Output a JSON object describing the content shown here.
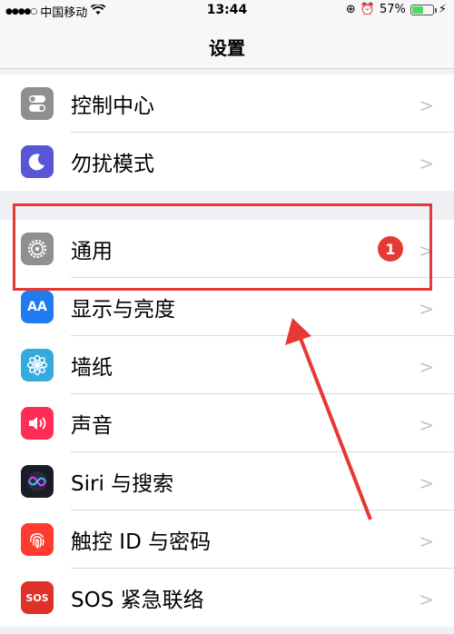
{
  "status_bar": {
    "carrier": "中国移动",
    "time": "13:44",
    "battery": "57%",
    "battery_level": 0.57
  },
  "nav": {
    "title": "设置"
  },
  "groups": [
    {
      "items": [
        {
          "label": "控制中心",
          "icon": "control-center-icon",
          "color": "#8e8e93"
        },
        {
          "label": "勿扰模式",
          "icon": "moon-icon",
          "color": "#5856d6"
        }
      ]
    },
    {
      "items": [
        {
          "label": "通用",
          "icon": "gear-icon",
          "color": "#8e8e93",
          "badge": "1"
        },
        {
          "label": "显示与亮度",
          "icon": "display-brightness-icon",
          "color": "#1e7cf0",
          "icon_text": "AA"
        },
        {
          "label": "墙纸",
          "icon": "wallpaper-flower-icon",
          "color": "#35aadc"
        },
        {
          "label": "声音",
          "icon": "speaker-icon",
          "color": "#ff2d55"
        },
        {
          "label": "Siri 与搜索",
          "icon": "siri-icon",
          "color": "#1c1c28"
        },
        {
          "label": "触控 ID 与密码",
          "icon": "fingerprint-icon",
          "color": "#ff3b30"
        },
        {
          "label": "SOS 紧急联络",
          "icon": "sos-icon",
          "color": "#e0302a",
          "icon_text": "SOS"
        }
      ]
    }
  ],
  "annotation": {
    "color": "#e53935"
  }
}
